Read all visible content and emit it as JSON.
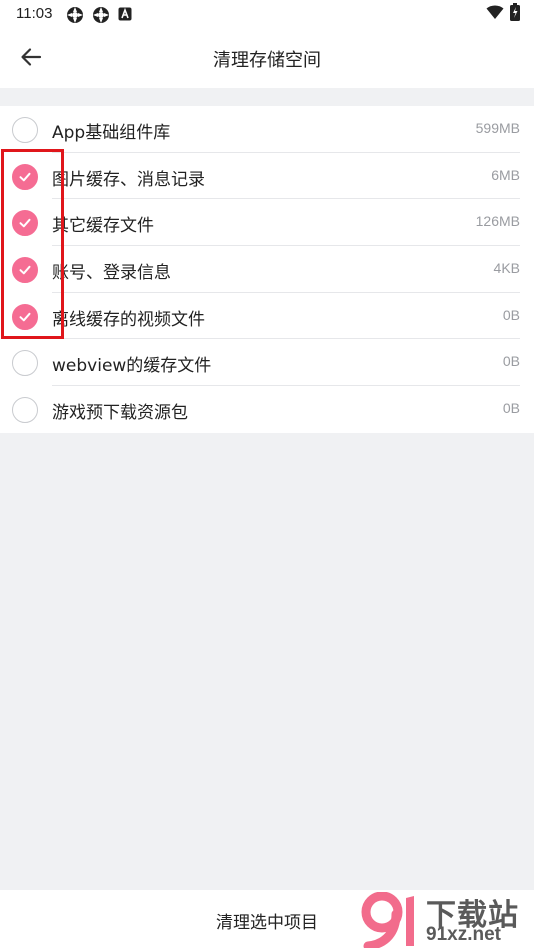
{
  "status_bar": {
    "time": "11:03",
    "left_icons": [
      "app-notification-icon",
      "app-notification-icon",
      "android-a-icon"
    ],
    "right_icons": [
      "wifi-icon",
      "battery-charging-icon"
    ]
  },
  "header": {
    "title": "清理存储空间",
    "back_icon": "arrow-left-icon"
  },
  "items": [
    {
      "label": "App基础组件库",
      "size": "599MB",
      "checked": false
    },
    {
      "label": "图片缓存、消息记录",
      "size": "6MB",
      "checked": true
    },
    {
      "label": "其它缓存文件",
      "size": "126MB",
      "checked": true
    },
    {
      "label": "账号、登录信息",
      "size": "4KB",
      "checked": true
    },
    {
      "label": "离线缓存的视频文件",
      "size": "0B",
      "checked": true
    },
    {
      "label": "webview的缓存文件",
      "size": "0B",
      "checked": false
    },
    {
      "label": "游戏预下载资源包",
      "size": "0B",
      "checked": false
    }
  ],
  "bottom": {
    "clean_label": "清理选中项目"
  },
  "watermark": {
    "title": "下载站",
    "domain": "91xz.net"
  },
  "colors": {
    "accent": "#f56c93",
    "highlight_border": "#e0161b",
    "background": "#f0f1f3"
  }
}
